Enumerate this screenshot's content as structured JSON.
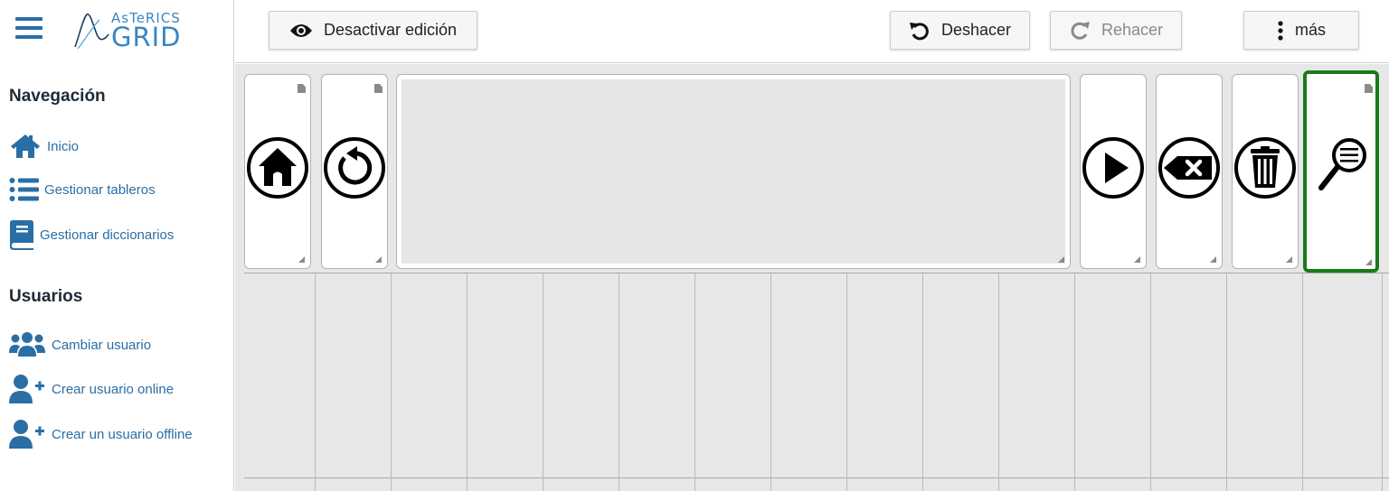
{
  "app": {
    "logo_top": "AsTeRICS",
    "logo_bottom": "GRID"
  },
  "sidebar": {
    "nav_title": "Navegación",
    "nav_items": [
      {
        "label": "Inicio",
        "icon": "home-icon"
      },
      {
        "label": "Gestionar tableros",
        "icon": "list-icon"
      },
      {
        "label": "Gestionar diccionarios",
        "icon": "book-icon"
      }
    ],
    "users_title": "Usuarios",
    "user_items": [
      {
        "label": "Cambiar usuario",
        "icon": "users-icon"
      },
      {
        "label": "Crear usuario online",
        "icon": "user-plus-icon"
      },
      {
        "label": "Crear un usuario offline",
        "icon": "user-plus-icon"
      }
    ]
  },
  "toolbar": {
    "edit_toggle_label": "Desactivar edición",
    "undo_label": "Deshacer",
    "redo_label": "Rehacer",
    "more_label": "más"
  },
  "grid": {
    "cells": [
      {
        "icon": "home-circle-icon"
      },
      {
        "icon": "undo-circle-icon"
      },
      {
        "icon": "text-collect-area"
      },
      {
        "icon": "play-circle-icon"
      },
      {
        "icon": "backspace-circle-icon"
      },
      {
        "icon": "trash-circle-icon"
      },
      {
        "icon": "magnifier-lines-icon",
        "selected": true
      }
    ]
  },
  "colors": {
    "accent": "#2a6ea6",
    "selected_border": "#1a7a1a",
    "grid_background": "#e7e7e7"
  }
}
